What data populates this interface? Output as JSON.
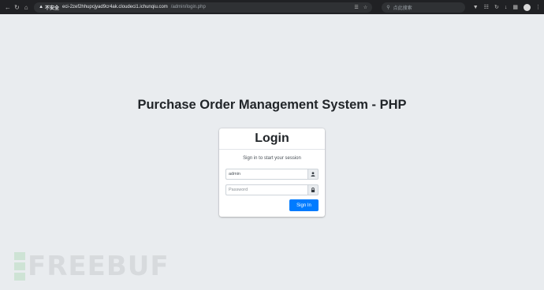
{
  "browser": {
    "security_label": "不安全",
    "url_host": "eci-2zef2hhupcjyad9cr4ak.cloudeci1.ichunqiu.com",
    "url_path": "/admin/login.php",
    "search_placeholder": "点此搜索"
  },
  "page": {
    "title": "Purchase Order Management System - PHP"
  },
  "login": {
    "heading": "Login",
    "message": "Sign in to start your session",
    "username_value": "admin",
    "password_placeholder": "Password",
    "signin_label": "Sign In"
  },
  "colors": {
    "primary": "#007bff",
    "background": "#e9ecef"
  },
  "watermark": {
    "text": "FREEBUF"
  }
}
